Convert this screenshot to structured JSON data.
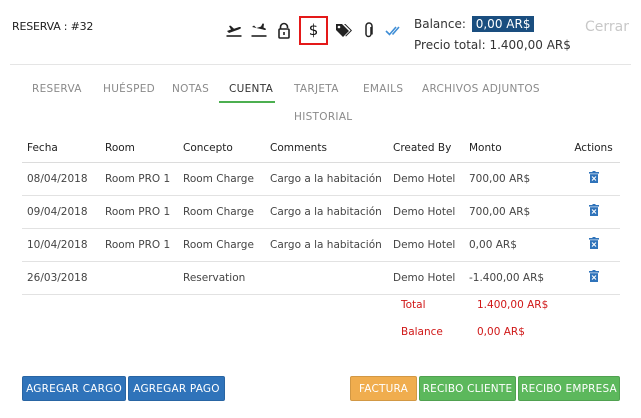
{
  "header": {
    "reservation_title": "RESERVA : #32",
    "balance_label": "Balance:",
    "balance_value": "0,00 AR$",
    "total_label": "Precio total: 1.400,00 AR$",
    "close_label": "Cerrar",
    "selected_icon": "$",
    "icons": [
      "plane-departure-icon",
      "plane-arrival-icon",
      "lock-icon",
      "dollar-icon",
      "tag-icon",
      "paperclip-icon",
      "double-check-icon"
    ]
  },
  "tabs": [
    {
      "label": "RESERVA"
    },
    {
      "label": "HUÉSPED"
    },
    {
      "label": "NOTAS"
    },
    {
      "label": "CUENTA"
    },
    {
      "label": "TARJETA"
    },
    {
      "label": "EMAILS"
    },
    {
      "label": "ARCHIVOS ADJUNTOS"
    },
    {
      "label": "HISTORIAL"
    }
  ],
  "table": {
    "headers": {
      "fecha": "Fecha",
      "room": "Room",
      "concepto": "Concepto",
      "comments": "Comments",
      "created_by": "Created By",
      "monto": "Monto",
      "actions": "Actions"
    },
    "rows": [
      {
        "fecha": "08/04/2018",
        "room": "Room PRO 1",
        "concepto": "Room Charge",
        "comments": "Cargo a la habitación",
        "created_by": "Demo Hotel",
        "monto": "700,00 AR$"
      },
      {
        "fecha": "09/04/2018",
        "room": "Room PRO 1",
        "concepto": "Room Charge",
        "comments": "Cargo a la habitación",
        "created_by": "Demo Hotel",
        "monto": "700,00 AR$"
      },
      {
        "fecha": "10/04/2018",
        "room": "Room PRO 1",
        "concepto": "Room Charge",
        "comments": "Cargo a la habitación",
        "created_by": "Demo Hotel",
        "monto": "0,00 AR$"
      },
      {
        "fecha": "26/03/2018",
        "room": "",
        "concepto": "Reservation",
        "comments": "",
        "created_by": "Demo Hotel",
        "monto": "-1.400,00 AR$"
      }
    ]
  },
  "summary": {
    "total_label": "Total",
    "total_value": "1.400,00 AR$",
    "balance_label": "Balance",
    "balance_value": "0,00 AR$"
  },
  "buttons": {
    "agregar_cargo": "AGREGAR CARGO",
    "agregar_pago": "AGREGAR PAGO",
    "factura": "FACTURA",
    "recibo_cliente": "RECIBO CLIENTE",
    "recibo_empresa": "RECIBO EMPRESA"
  },
  "colors": {
    "badge": "#1a4e7f",
    "tab_active_underline": "#4caf50",
    "summary_red": "#d01818",
    "trash_blue": "#2f73ba",
    "btn_blue": "#2f73ba",
    "btn_orange": "#f0ad4e",
    "btn_green": "#5cb85c",
    "highlight_red": "#e41919"
  }
}
